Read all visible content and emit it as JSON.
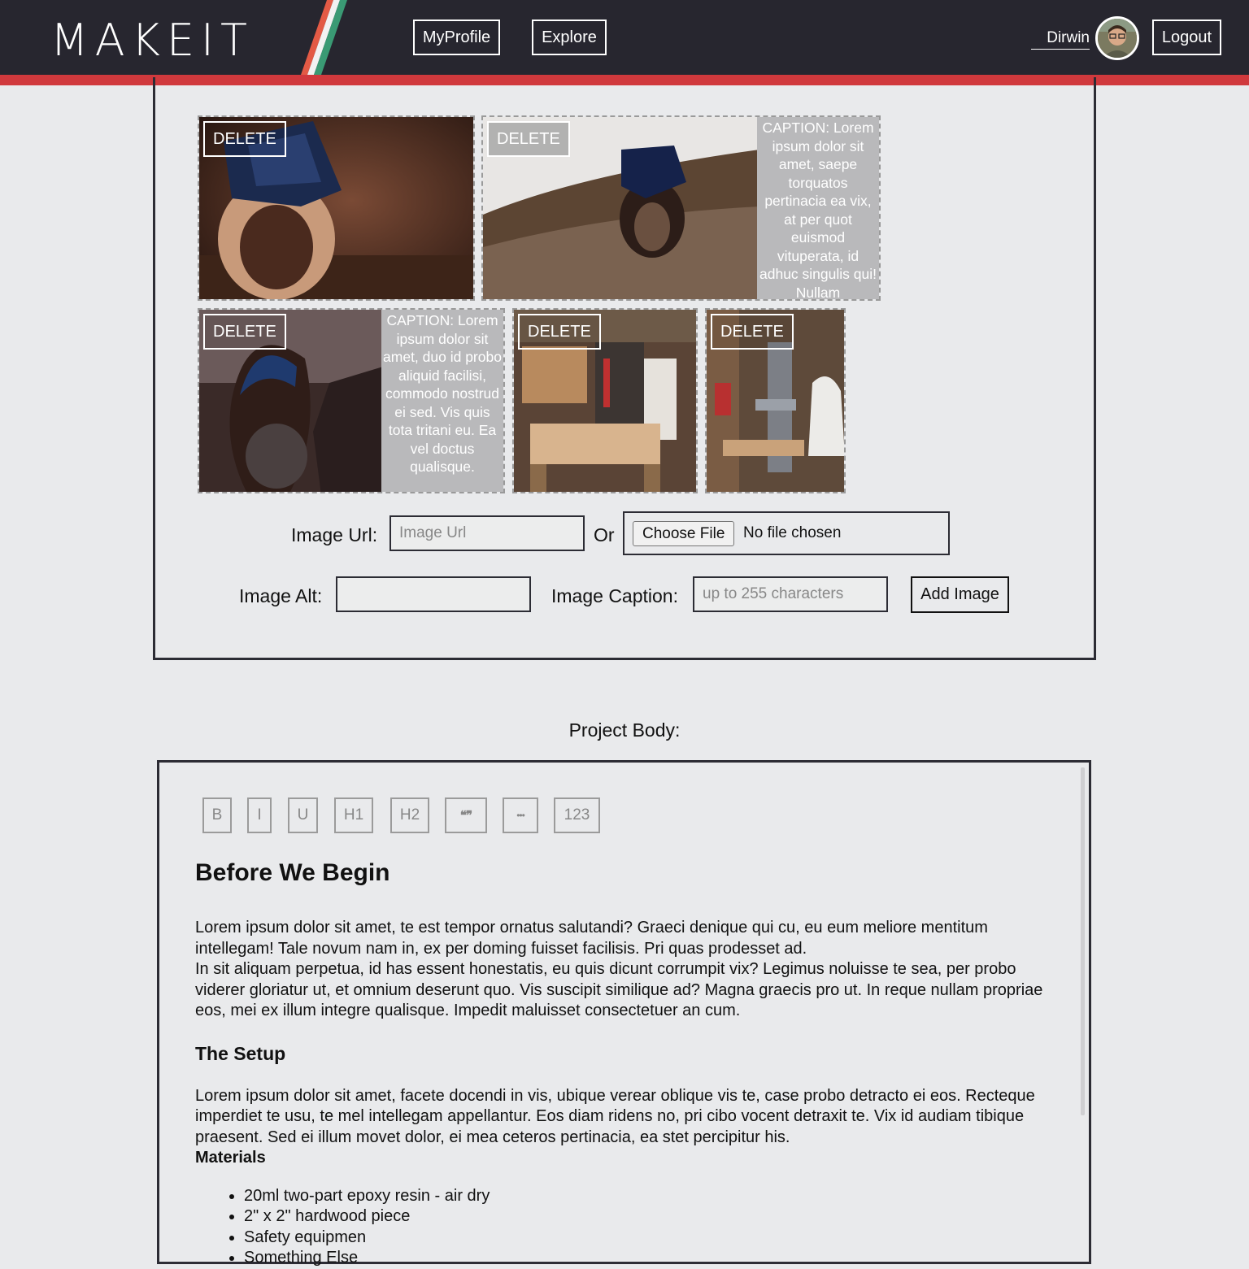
{
  "header": {
    "logo": "MAKEIT",
    "nav": [
      "MyProfile",
      "Explore"
    ],
    "username": "Dirwin",
    "logout": "Logout",
    "colors": {
      "bar": "#27262f",
      "accent": "#d0393d",
      "stripe_green": "#3a9a74",
      "stripe_orange": "#e07040"
    }
  },
  "gallery": {
    "delete_label": "DELETE",
    "captions": [
      "CAPTION: Lorem ipsum dolor sit amet, saepe torquatos pertinacia ea vix, at per quot euismod vituperata, id adhuc singulis qui! Nullam",
      "CAPTION: Lorem ipsum dolor sit amet, duo id probo aliquid facilisi, commodo nostrud ei sed. Vis quis tota tritani eu. Ea vel doctus qualisque."
    ]
  },
  "form": {
    "url_label": "Image Url:",
    "url_placeholder": "Image Url",
    "or_label": "Or",
    "choose_file": "Choose File",
    "no_file": "No file chosen",
    "alt_label": "Image Alt:",
    "caption_label": "Image Caption:",
    "caption_placeholder": "up to 255 characters",
    "add_button": "Add Image"
  },
  "editor": {
    "label": "Project Body:",
    "toolbar": [
      "B",
      "I",
      "U",
      "H1",
      "H2",
      "❝❞",
      "•••",
      "123"
    ],
    "heading1": "Before We Begin",
    "para1a": "Lorem ipsum dolor sit amet, te est tempor ornatus salutandi? Graeci denique qui cu, eu eum meliore mentitum intellegam! Tale novum nam in, ex per doming fuisset facilisis. Pri quas prodesset ad.",
    "para1b": "In sit aliquam perpetua, id has essent honestatis, eu quis dicunt corrumpit vix? Legimus noluisse te sea, per probo viderer gloriatur ut, et omnium deserunt quo. Vis suscipit similique ad? Magna graecis pro ut. In reque nullam propriae eos, mei ex illum integre qualisque. Impedit maluisset consectetuer an cum.",
    "heading2": "The Setup",
    "para2": "Lorem ipsum dolor sit amet, facete docendi in vis, ubique verear oblique vis te, case probo detracto ei eos. Recteque imperdiet te usu, te mel intellegam appellantur. Eos diam ridens no, pri cibo vocent detraxit te. Vix id audiam tibique praesent. Sed ei illum movet dolor, ei mea ceteros pertinacia, ea stet percipitur his.",
    "materials_label": "Materials",
    "materials": [
      "20ml two-part epoxy resin - air dry",
      "2\" x 2\" hardwood piece",
      "Safety equipmen",
      "Something Else"
    ]
  }
}
